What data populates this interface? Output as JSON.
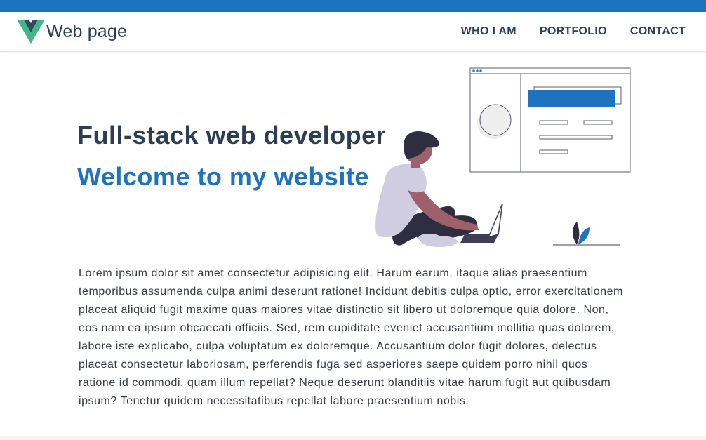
{
  "colors": {
    "accent": "#1e73be",
    "heading": "#2c3e50",
    "logo_green": "#41b883",
    "logo_dark": "#35495e"
  },
  "header": {
    "brand": "Web page",
    "nav": [
      "WHO I AM",
      "PORTFOLIO",
      "CONTACT"
    ]
  },
  "hero": {
    "title": "Full-stack web developer",
    "subtitle": "Welcome to my website",
    "illustration": "developer-with-laptop"
  },
  "content": {
    "paragraph": "Lorem ipsum dolor sit amet consectetur adipisicing elit. Harum earum, itaque alias praesentium temporibus assumenda culpa animi deserunt ratione! Incidunt debitis culpa optio, error exercitationem placeat aliquid fugit maxime quas maiores vitae distinctio sit libero ut doloremque quia dolore. Non, eos nam ea ipsum obcaecati officiis. Sed, rem cupiditate eveniet accusantium mollitia quas dolorem, labore iste explicabo, culpa voluptatum ex doloremque. Accusantium dolor fugit dolores, delectus placeat consectetur laboriosam, perferendis fuga sed asperiores saepe quidem porro nihil quos ratione id commodi, quam illum repellat? Neque deserunt blanditiis vitae harum fugit aut quibusdam ipsum? Tenetur quidem necessitatibus repellat labore praesentium nobis."
  }
}
